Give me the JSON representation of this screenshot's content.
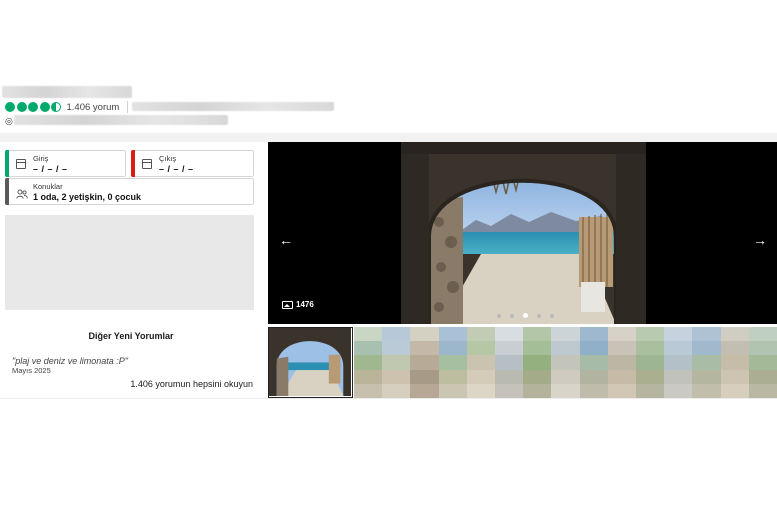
{
  "header": {
    "rating_bubbles": 4.5,
    "review_count_text": "1.406 yorum",
    "location_icon": "location-pin-icon"
  },
  "booking": {
    "checkin_label": "Giriş",
    "checkin_value": "– / – / –",
    "checkout_label": "Çıkış",
    "checkout_value": "– / – / –",
    "guests_label": "Konuklar",
    "guests_value": "1 oda, 2 yetişkin, 0 çocuk"
  },
  "reviews": {
    "section_title": "Diğer Yeni Yorumlar",
    "items": [
      {
        "quote": "\"plaj ve deniz ve limonata :P\"",
        "date": "Mayıs 2025"
      }
    ],
    "read_all_link": "1.406 yorumun hepsini okuyun"
  },
  "gallery": {
    "photo_count": "1476",
    "total_dots": 5,
    "active_dot": 3,
    "prev_icon": "arrow-left-icon",
    "next_icon": "arrow-right-icon"
  },
  "colors": {
    "accent_green": "#00aa6c",
    "checkout_red": "#d91e18"
  }
}
